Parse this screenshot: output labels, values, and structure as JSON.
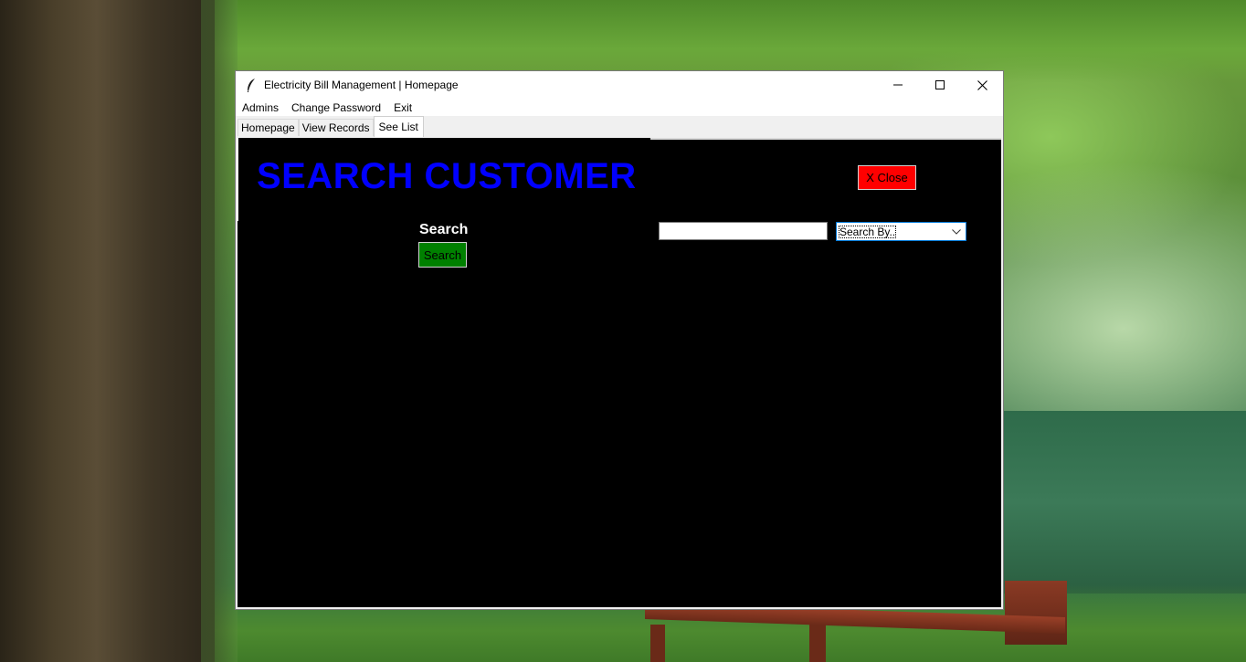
{
  "window": {
    "title": "Electricity Bill Management | Homepage",
    "controls": {
      "minimize": "—",
      "maximize": "☐",
      "close": "✕"
    }
  },
  "menu": [
    "Admins",
    "Change Password",
    "Exit"
  ],
  "tabs": [
    {
      "label": "Homepage",
      "active": false
    },
    {
      "label": "View Records",
      "active": false
    },
    {
      "label": "See List",
      "active": true
    }
  ],
  "content": {
    "heading": "SEARCH CUSTOMER",
    "close_button": "X Close",
    "search_label": "Search",
    "search_button": "Search",
    "search_input": {
      "value": ""
    },
    "search_by": {
      "selected": "Search By.."
    }
  },
  "colors": {
    "heading": "#0000ff",
    "close_button_bg": "#ff0000",
    "search_button_bg": "#008000",
    "content_bg": "#000000"
  },
  "icons": {
    "app": "feather-icon",
    "dropdown": "chevron-down-icon"
  }
}
